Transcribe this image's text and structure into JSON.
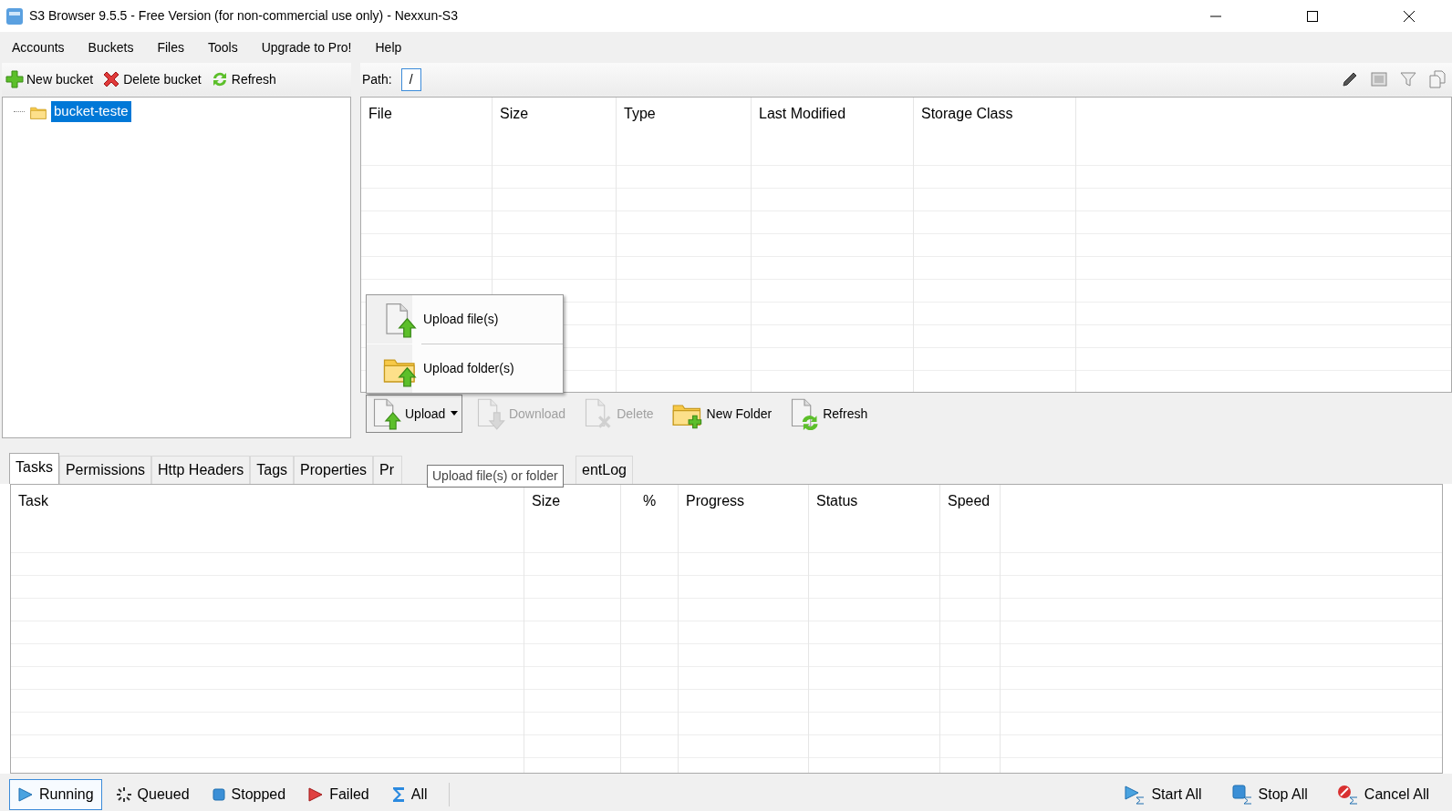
{
  "window": {
    "title": "S3 Browser 9.5.5 - Free Version (for non-commercial use only) - Nexxun-S3"
  },
  "menu": [
    "Accounts",
    "Buckets",
    "Files",
    "Tools",
    "Upgrade to Pro!",
    "Help"
  ],
  "bucket_toolbar": [
    {
      "label": "New bucket",
      "kind": "add"
    },
    {
      "label": "Delete bucket",
      "kind": "delete"
    },
    {
      "label": "Refresh",
      "kind": "refresh"
    }
  ],
  "buckets": [
    {
      "label": "bucket-teste",
      "selected": true
    }
  ],
  "path": {
    "label": "Path:",
    "value": "/"
  },
  "file_columns": [
    "File",
    "Size",
    "Type",
    "Last Modified",
    "Storage Class"
  ],
  "file_actions": [
    {
      "label": "Upload",
      "kind": "upload",
      "disabled": false
    },
    {
      "label": "Download",
      "kind": "download",
      "disabled": true
    },
    {
      "label": "Delete",
      "kind": "delete",
      "disabled": true
    },
    {
      "label": "New Folder",
      "kind": "newfolder",
      "disabled": false
    },
    {
      "label": "Refresh",
      "kind": "refresh",
      "disabled": false
    }
  ],
  "upload_menu": [
    {
      "label": "Upload file(s)",
      "kind": "file"
    },
    {
      "label": "Upload folder(s)",
      "kind": "folder"
    }
  ],
  "tabs": [
    {
      "label": "Tasks",
      "selected": true
    },
    {
      "label": "Permissions",
      "selected": false
    },
    {
      "label": "Http Headers",
      "selected": false
    },
    {
      "label": "Tags",
      "selected": false
    },
    {
      "label": "Properties",
      "selected": false
    },
    {
      "label": "Pr",
      "selected": false
    },
    {
      "label": "entLog",
      "selected": false
    }
  ],
  "tooltip": "Upload file(s) or folder",
  "task_columns": [
    "Task",
    "Size",
    "%",
    "Progress",
    "Status",
    "Speed"
  ],
  "task_filters": [
    {
      "label": "Running",
      "kind": "running",
      "selected": true
    },
    {
      "label": "Queued",
      "kind": "queued",
      "selected": false
    },
    {
      "label": "Stopped",
      "kind": "stopped",
      "selected": false
    },
    {
      "label": "Failed",
      "kind": "failed",
      "selected": false
    },
    {
      "label": "All",
      "kind": "all",
      "selected": false
    }
  ],
  "task_actions": [
    {
      "label": "Start All",
      "kind": "start"
    },
    {
      "label": "Stop All",
      "kind": "stop"
    },
    {
      "label": "Cancel All",
      "kind": "cancel"
    }
  ]
}
